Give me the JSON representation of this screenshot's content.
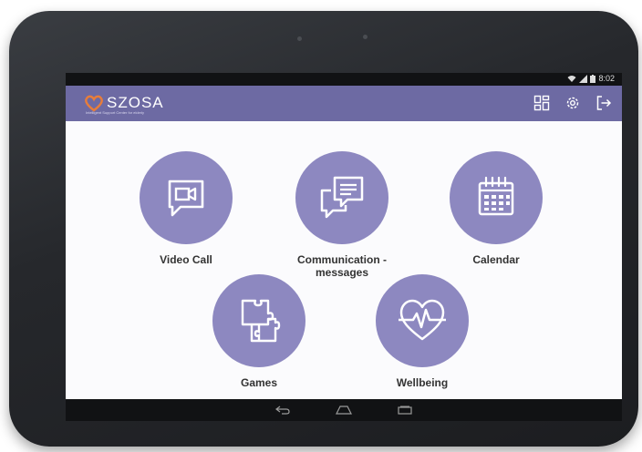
{
  "status_bar": {
    "time": "8:02"
  },
  "app": {
    "logo_text": "SZOSA",
    "logo_subtitle": "Intelligent Support Center for elderly"
  },
  "tiles": [
    {
      "label": "Video Call",
      "icon": "video-call-icon"
    },
    {
      "label": "Communication -\nmessages",
      "icon": "chat-bubbles-icon"
    },
    {
      "label": "Calendar",
      "icon": "calendar-icon"
    },
    {
      "label": "Games",
      "icon": "puzzle-icon"
    },
    {
      "label": "Wellbeing",
      "icon": "heartbeat-icon"
    }
  ],
  "colors": {
    "appbar": "#6d6aa3",
    "tile_circle": "#8d88c0",
    "logo_heart": "#e87d3a"
  }
}
